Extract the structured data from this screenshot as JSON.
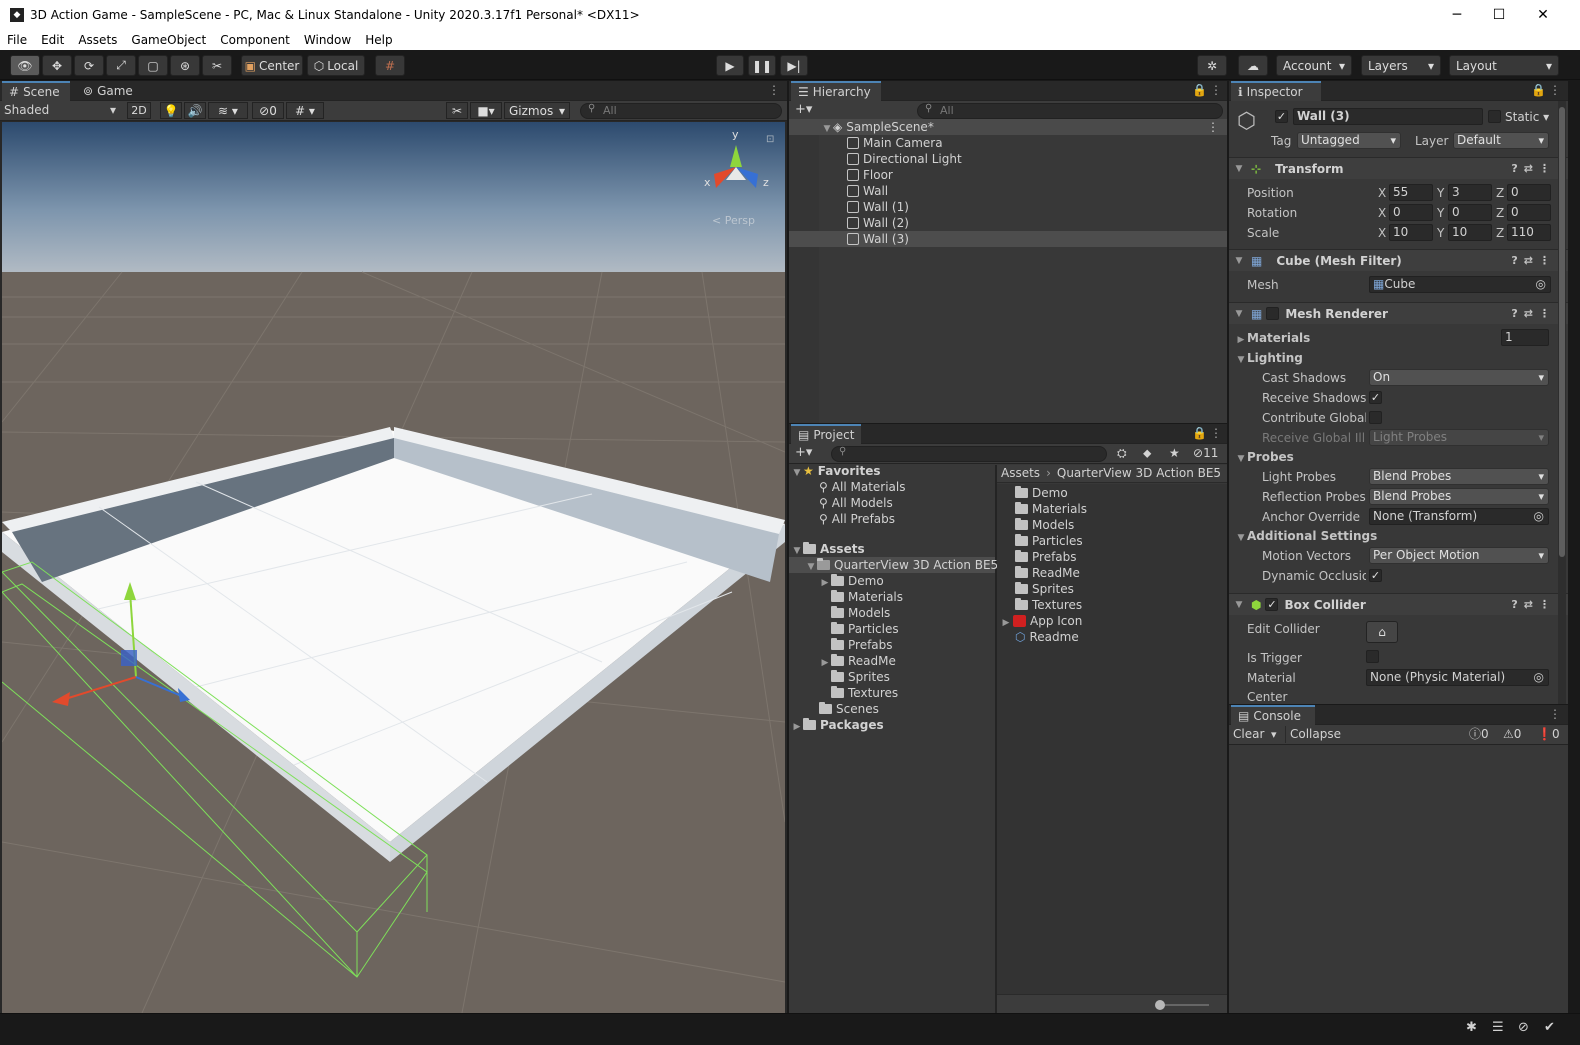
{
  "window": {
    "title": "3D Action Game - SampleScene - PC, Mac & Linux Standalone - Unity 2020.3.17f1 Personal* <DX11>",
    "minimize": "─",
    "maximize": "☐",
    "close": "✕"
  },
  "menu": [
    "File",
    "Edit",
    "Assets",
    "GameObject",
    "Component",
    "Window",
    "Help"
  ],
  "toolbar": {
    "center_label": "Center",
    "local_label": "Local",
    "account_label": "Account",
    "layers_label": "Layers",
    "layout_label": "Layout"
  },
  "scene": {
    "tab_scene": "Scene",
    "tab_game": "Game",
    "shading_mode": "Shaded",
    "mode_2d": "2D",
    "hidden_count": "0",
    "gizmos_label": "Gizmos",
    "search_placeholder": "All",
    "persp_label": "< Persp",
    "axis_x": "x",
    "axis_y": "y",
    "axis_z": "z"
  },
  "hierarchy": {
    "tab": "Hierarchy",
    "search_placeholder": "All",
    "scene_name": "SampleScene*",
    "objects": [
      "Main Camera",
      "Directional Light",
      "Floor",
      "Wall",
      "Wall (1)",
      "Wall (2)",
      "Wall (3)"
    ],
    "selected": "Wall (3)"
  },
  "project": {
    "tab": "Project",
    "hidden_count": "11",
    "favorites_label": "Favorites",
    "favorites": [
      "All Materials",
      "All Models",
      "All Prefabs"
    ],
    "assets_label": "Assets",
    "root_folder": "QuarterView 3D Action BE5",
    "subfolders": [
      "Demo",
      "Materials",
      "Models",
      "Particles",
      "Prefabs",
      "ReadMe",
      "Sprites",
      "Textures"
    ],
    "scenes_label": "Scenes",
    "packages_label": "Packages",
    "breadcrumb_assets": "Assets",
    "breadcrumb_folder": "QuarterView 3D Action BE5",
    "files": [
      "Demo",
      "Materials",
      "Models",
      "Particles",
      "Prefabs",
      "ReadMe",
      "Sprites",
      "Textures",
      "App Icon",
      "Readme"
    ]
  },
  "inspector": {
    "tab": "Inspector",
    "object_name": "Wall (3)",
    "static_label": "Static",
    "tag_label": "Tag",
    "tag_value": "Untagged",
    "layer_label": "Layer",
    "layer_value": "Default",
    "transform": {
      "title": "Transform",
      "position_label": "Position",
      "position": [
        "55",
        "3",
        "0"
      ],
      "rotation_label": "Rotation",
      "rotation": [
        "0",
        "0",
        "0"
      ],
      "scale_label": "Scale",
      "scale": [
        "10",
        "10",
        "110"
      ]
    },
    "mesh_filter": {
      "title": "Cube (Mesh Filter)",
      "mesh_label": "Mesh",
      "mesh_value": "Cube"
    },
    "mesh_renderer": {
      "title": "Mesh Renderer",
      "materials_label": "Materials",
      "materials_count": "1",
      "lighting_label": "Lighting",
      "cast_shadows_label": "Cast Shadows",
      "cast_shadows_value": "On",
      "receive_shadows_label": "Receive Shadows",
      "contribute_gi_label": "Contribute Global I",
      "receive_gi_label": "Receive Global Illu",
      "receive_gi_value": "Light Probes",
      "probes_label": "Probes",
      "light_probes_label": "Light Probes",
      "light_probes_value": "Blend Probes",
      "reflection_probes_label": "Reflection Probes",
      "reflection_probes_value": "Blend Probes",
      "anchor_override_label": "Anchor Override",
      "anchor_override_value": "None (Transform)",
      "additional_label": "Additional Settings",
      "motion_vectors_label": "Motion Vectors",
      "motion_vectors_value": "Per Object Motion",
      "dynamic_occlusion_label": "Dynamic Occlusio"
    },
    "box_collider": {
      "title": "Box Collider",
      "edit_collider_label": "Edit Collider",
      "is_trigger_label": "Is Trigger",
      "material_label": "Material",
      "material_value": "None (Physic Material)",
      "center_label": "Center"
    },
    "axis_labels": [
      "X",
      "Y",
      "Z"
    ]
  },
  "console": {
    "tab": "Console",
    "clear_label": "Clear",
    "collapse_label": "Collapse",
    "log_count": "0",
    "warn_count": "0",
    "error_count": "0"
  }
}
